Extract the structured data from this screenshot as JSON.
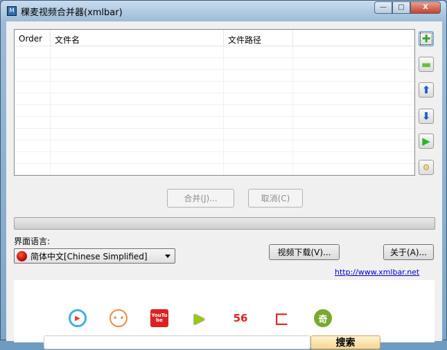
{
  "window": {
    "title": "稞麦视频合并器(xmlbar)",
    "minimize": "—",
    "maximize": "□",
    "close": "X"
  },
  "table": {
    "columns": [
      "Order",
      "文件名",
      "文件路径",
      ""
    ],
    "rows": 11
  },
  "side_buttons": [
    "add",
    "remove",
    "move-up",
    "move-down",
    "play",
    "settings"
  ],
  "buttons": {
    "merge": "合并(J)...",
    "cancel": "取消(C)",
    "video_download": "视频下载(V)...",
    "about": "关于(A)..."
  },
  "progress": 0,
  "language": {
    "label": "界面语言:",
    "selected": "简体中文[Chinese Simplified]"
  },
  "link": "http://www.xmlbar.net",
  "sites": [
    "youku",
    "tudou",
    "YouTube",
    "iqiyi-like",
    "56",
    "letv",
    "qiyi"
  ],
  "search": {
    "button": "搜索"
  }
}
